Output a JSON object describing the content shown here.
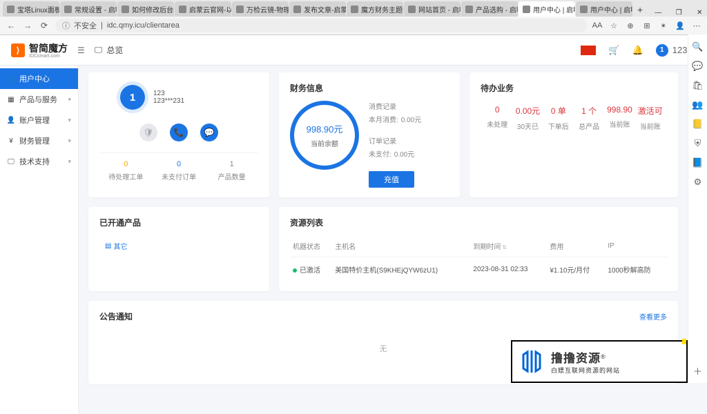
{
  "browser": {
    "url": "idc.qmy.icu/clientarea",
    "security": "不安全",
    "tabs": [
      {
        "t": "宝塔Linux面板"
      },
      {
        "t": "常规设置 - 启明"
      },
      {
        "t": "如何修改后台的"
      },
      {
        "t": "启蒙云官网-以IT"
      },
      {
        "t": "万检云镜-物理服"
      },
      {
        "t": "发布文章-启蒙"
      },
      {
        "t": "魔方财务主题特"
      },
      {
        "t": "网站首页 - 启明"
      },
      {
        "t": "产品选购 - 启明"
      },
      {
        "t": "用户中心 | 启明",
        "active": true
      },
      {
        "t": "用户中心 | 启明"
      }
    ],
    "win": {
      "min": "—",
      "max": "❐",
      "close": "✕"
    },
    "addr_right": {
      "aa": "AA",
      "star": "☆",
      "plus": "⊕",
      "apps": "⊞",
      "pct": "%",
      "ext": "✴",
      "user": "👤",
      "more": "⋯"
    }
  },
  "rail": {
    "i0": "🔍",
    "i1": "💬",
    "i2": "🛍",
    "i3": "👥",
    "i4": "📒",
    "i5": "⛨",
    "i6": "📘",
    "i7": "⚙",
    "i8": "＋"
  },
  "header": {
    "brand": "智简魔方",
    "brand_sub": "IDCsmart.com",
    "overview": "总览",
    "flag": "",
    "cart": "🛒",
    "bell": "🔔",
    "user": "123",
    "chev": "▾",
    "avatar": "1"
  },
  "sidenav": [
    {
      "icon": "👤",
      "label": "用户中心",
      "active": true
    },
    {
      "icon": "▦",
      "label": "产品与服务",
      "chev": "▾"
    },
    {
      "icon": "👤",
      "label": "账户管理",
      "chev": "▾"
    },
    {
      "icon": "¥",
      "label": "财务管理",
      "chev": "▾"
    },
    {
      "icon": "🖵",
      "label": "技术支持",
      "chev": "▾"
    }
  ],
  "profile": {
    "avatar": "1",
    "name": "123",
    "phone": "123***231",
    "ic_shield": "🛡",
    "ic_phone": "📞",
    "ic_msg": "💬",
    "stats": [
      {
        "val": "0",
        "lbl": "待处理工单",
        "cls": "stat-val"
      },
      {
        "val": "0",
        "lbl": "未支付订单",
        "cls": "stat-val blue"
      },
      {
        "val": "1",
        "lbl": "产品数量",
        "cls": "stat-val grey"
      }
    ]
  },
  "finance": {
    "title": "财务信息",
    "balance": "998.90元",
    "balance_lbl": "当前余额",
    "spend_title": "消费记录",
    "spend_label": "本月消费:",
    "spend_val": "0.00元",
    "order_title": "订单记录",
    "unpaid_label": "未支付:",
    "unpaid_val": "0.00元",
    "btn": "充值"
  },
  "todo": {
    "title": "待办业务",
    "items": [
      {
        "val": "0",
        "lbl": "未处理"
      },
      {
        "val": "0.00元",
        "lbl": "30天已"
      },
      {
        "val": "0 单",
        "lbl": "下单后"
      },
      {
        "val": "1 个",
        "lbl": "总产品"
      },
      {
        "val": "998.90",
        "lbl": "当前账"
      },
      {
        "val": "激活可",
        "lbl": "当前账"
      }
    ]
  },
  "opened": {
    "title": "已开通产品",
    "other_icon": "▤",
    "other_label": "其它"
  },
  "resources": {
    "title": "资源列表",
    "cols": {
      "status": "机器状态",
      "host": "主机名",
      "expire": "到期时间",
      "cost": "费用",
      "ip": "IP"
    },
    "row": {
      "status": "已激活",
      "host": "美国特价主机(S9KHEjQYW6zU1)",
      "expire": "2023-08-31 02:33",
      "cost": "¥1.10元/月付",
      "ip": "1000秒解高防"
    }
  },
  "notice": {
    "title": "公告通知",
    "more": "查看更多",
    "empty": "无"
  },
  "watermark": {
    "name": "撸撸资源",
    "reg": "®",
    "sub": "白嫖互联网资源的网站"
  }
}
